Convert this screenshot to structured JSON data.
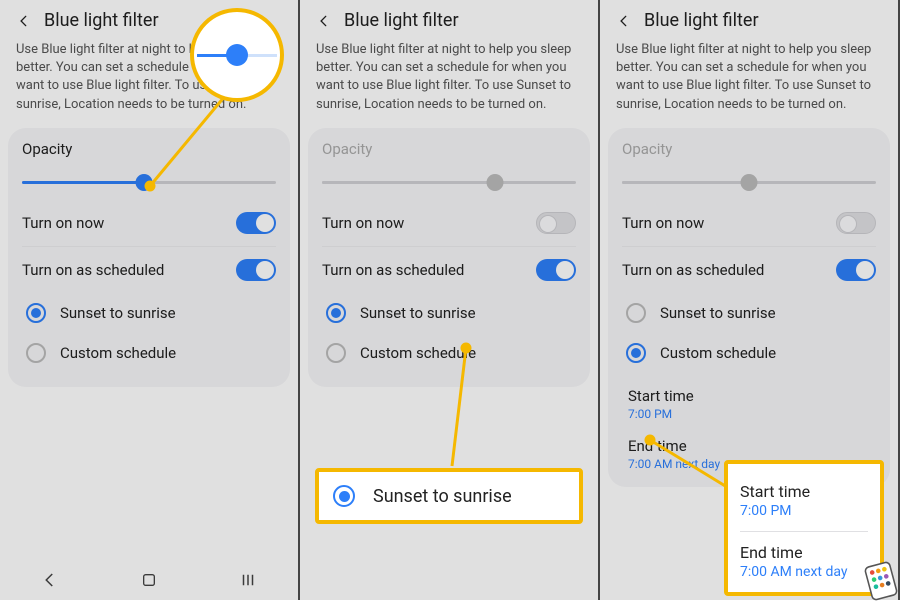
{
  "colors": {
    "accent": "#2d7ff9",
    "highlight": "#f5b800"
  },
  "header": {
    "title": "Blue light filter"
  },
  "description": "Use Blue light filter at night to help you sleep better. You can set a schedule for when you want to use Blue light filter. To use Sunset to sunrise, Location needs to be turned on.",
  "opacity_label": "Opacity",
  "toggles": {
    "turn_on_now": "Turn on now",
    "turn_on_scheduled": "Turn on as scheduled"
  },
  "schedule_options": {
    "sunset": "Sunset to sunrise",
    "custom": "Custom schedule"
  },
  "pane1": {
    "slider_percent": 48,
    "now_on": true,
    "scheduled_on": true,
    "selected": "sunset"
  },
  "pane2": {
    "slider_percent": 68,
    "now_on": false,
    "scheduled_on": true,
    "selected": "sunset"
  },
  "pane3": {
    "slider_percent": 50,
    "now_on": false,
    "scheduled_on": true,
    "selected": "custom",
    "start": {
      "label": "Start time",
      "value": "7:00 PM"
    },
    "end": {
      "label": "End time",
      "value": "7:00 AM next day"
    }
  },
  "callouts": {
    "sunset_label": "Sunset to sunrise",
    "time_start_label": "Start time",
    "time_start_value": "7:00 PM",
    "time_end_label": "End time",
    "time_end_value": "7:00 AM next day"
  }
}
